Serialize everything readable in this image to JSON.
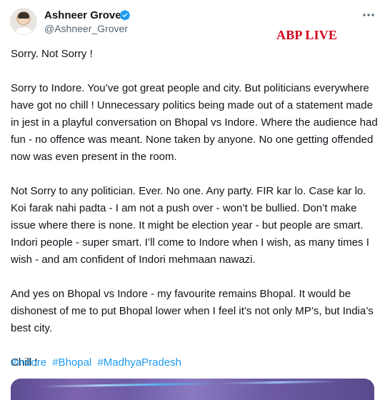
{
  "author": {
    "name": "Ashneer Grover",
    "handle": "@Ashneer_Grover",
    "verified": true,
    "verified_color": "#1d9bf0"
  },
  "watermark": "ABP LIVE",
  "tweet": {
    "paragraphs": [
      "Sorry. Not Sorry !",
      "Sorry to Indore. You’ve got great people and city. But politicians everywhere have got no chill ! Unnecessary politics being made out of a statement made in jest in a playful conversation on Bhopal vs Indore. Where the audience had fun - no offence was meant. None taken by anyone. No one getting offended now was even present in the room.",
      "Not Sorry to any politician. Ever. No one. Any party. FIR kar lo. Case kar lo. Koi farak nahi padta - I am not a push over - won’t be bullied. Don’t make issue where there is none. It might be election year - but people are smart. Indori people - super smart. I’ll come to Indore when I wish, as many times I wish - and am confident of Indori mehmaan nawazi.",
      "And yes on Bhopal vs Indore - my favourite remains Bhopal. It would be dishonest of me to put Bhopal lower when I feel it’s not only MP’s, but India’s best city.",
      "Chill !"
    ],
    "hashtags": [
      "#indore",
      "#Bhopal",
      "#MadhyaPradesh"
    ]
  },
  "icons": {
    "verified": "verified-badge-icon",
    "more": "more-options-icon"
  },
  "colors": {
    "text": "#0f1419",
    "secondary": "#536471",
    "link": "#1d9bf0",
    "watermark": "#d0021b"
  }
}
